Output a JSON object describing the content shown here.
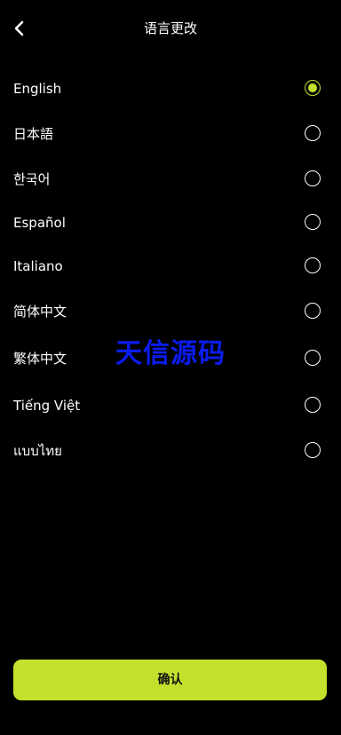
{
  "header": {
    "title": "语言更改"
  },
  "languages": [
    {
      "label": "English",
      "selected": true
    },
    {
      "label": "日本語",
      "selected": false
    },
    {
      "label": "한국어",
      "selected": false
    },
    {
      "label": "Español",
      "selected": false
    },
    {
      "label": "Italiano",
      "selected": false
    },
    {
      "label": "简体中文",
      "selected": false
    },
    {
      "label": "繁体中文",
      "selected": false
    },
    {
      "label": "Tiếng Việt",
      "selected": false
    },
    {
      "label": "แบบไทย",
      "selected": false
    }
  ],
  "watermark": "天信源码",
  "confirm_label": "确认",
  "colors": {
    "accent": "#c5e02c",
    "background": "#000000",
    "watermark": "#0a1cf0"
  }
}
